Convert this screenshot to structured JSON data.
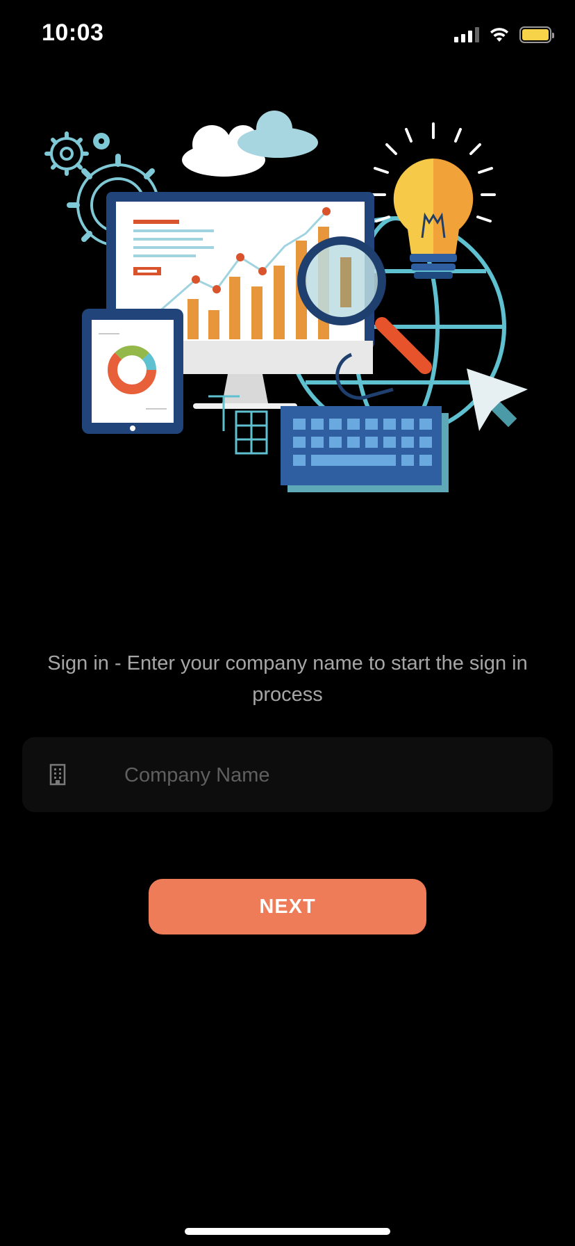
{
  "status_bar": {
    "time": "10:03",
    "icons": [
      "cellular-signal-icon",
      "wifi-icon",
      "battery-icon"
    ],
    "battery_color": "#f7d34a"
  },
  "hero": {
    "icon": "analytics-illustration",
    "elements": [
      "gears-icon",
      "cloud-icon",
      "monitor-chart-icon",
      "magnifier-icon",
      "lightbulb-icon",
      "globe-icon",
      "tablet-pie-chart-icon",
      "keyboard-icon",
      "cursor-icon"
    ]
  },
  "signin": {
    "prompt": "Sign in - Enter your company name to start the sign in process",
    "company_field": {
      "icon": "building-icon",
      "value": "",
      "placeholder": "Company Name"
    },
    "next_label": "NEXT",
    "accent_color": "#ef7c58"
  }
}
